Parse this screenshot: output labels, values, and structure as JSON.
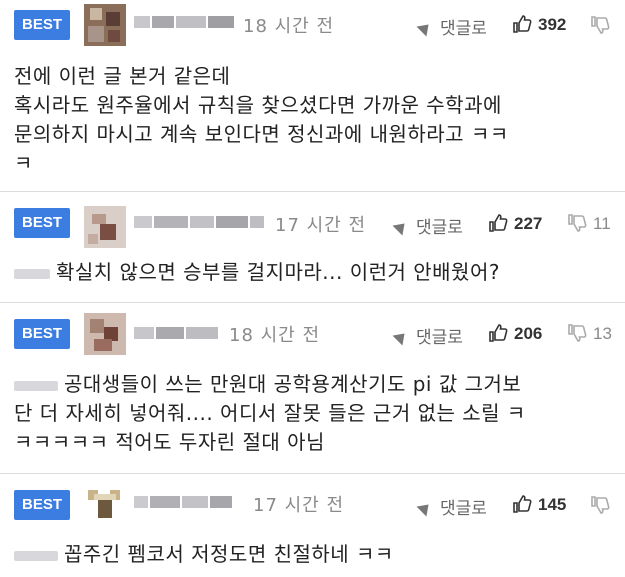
{
  "comments": [
    {
      "badge": "BEST",
      "time": "18 시간 전",
      "reply_label": "댓글로",
      "likes": "392",
      "dislikes": "",
      "text_lines": [
        "전에 이런 글 본거 같은데",
        "혹시라도 원주율에서 규칙을 찾으셨다면 가까운 수학과에",
        "문의하지 마시고 계속 보인다면 정신과에 내원하라고 ㅋㅋ",
        "ㅋ"
      ]
    },
    {
      "badge": "BEST",
      "time": "17 시간 전",
      "reply_label": "댓글로",
      "likes": "227",
      "dislikes": "11",
      "text_lines": [
        "확실치 않으면 승부를 걸지마라... 이런거 안배웠어?"
      ]
    },
    {
      "badge": "BEST",
      "time": "18 시간 전",
      "reply_label": "댓글로",
      "likes": "206",
      "dislikes": "13",
      "text_lines": [
        "공대생들이 쓰는 만원대 공학용계산기도 pi 값 그거보",
        "단 더 자세히 넣어줘.... 어디서 잘못 들은 근거 없는 소릴 ㅋ",
        "ㅋㅋㅋㅋㅋ 적어도 두자린 절대 아님"
      ]
    },
    {
      "badge": "BEST",
      "time": "17 시간 전",
      "reply_label": "댓글로",
      "likes": "145",
      "dislikes": "",
      "text_lines": [
        "꼽주긴 펨코서 저정도면 친절하네 ㅋㅋ"
      ]
    }
  ],
  "colors": {
    "badge_bg": "#3b7de0",
    "divider": "#dcdcdc",
    "meta": "#8a8a8a"
  },
  "icons": [
    "reply-arrow-icon",
    "thumbs-up-icon",
    "thumbs-down-icon"
  ]
}
